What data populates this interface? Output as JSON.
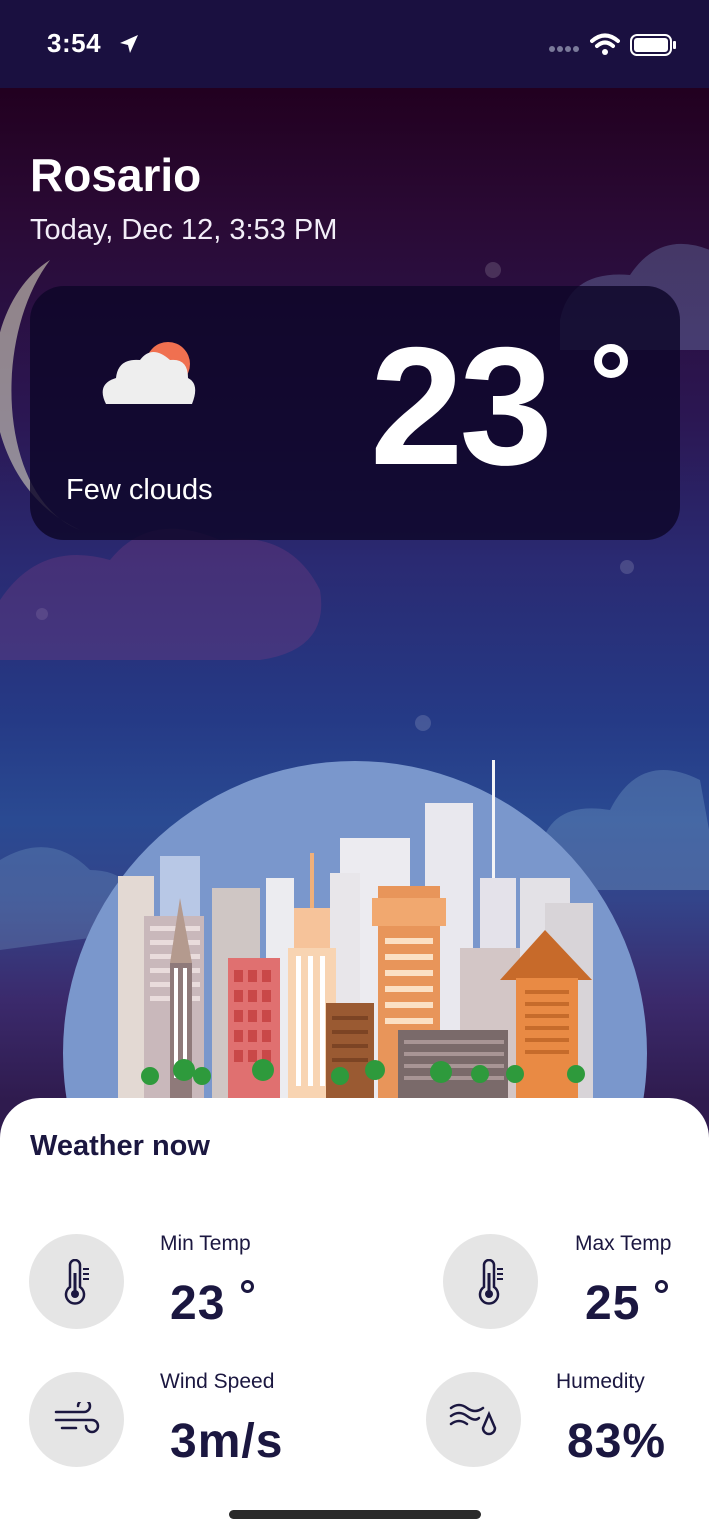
{
  "status_bar": {
    "time": "3:54"
  },
  "location": {
    "city": "Rosario",
    "datetime": "Today, Dec 12, 3:53 PM"
  },
  "current": {
    "temperature": "23",
    "description": "Few clouds",
    "icon": "few-clouds-icon"
  },
  "weather_now": {
    "title": "Weather now",
    "min_temp": {
      "label": "Min Temp",
      "value": "23",
      "icon": "thermometer-icon"
    },
    "max_temp": {
      "label": "Max Temp",
      "value": "25",
      "icon": "thermometer-icon"
    },
    "wind_speed": {
      "label": "Wind Speed",
      "value": "3m/s",
      "icon": "wind-icon"
    },
    "humidity": {
      "label": "Humedity",
      "value": "83%",
      "icon": "humidity-icon"
    }
  },
  "colors": {
    "accent_dark": "#1b1740",
    "stat_circle_bg": "#e5e5e5",
    "card_bg": "#0e0628"
  }
}
